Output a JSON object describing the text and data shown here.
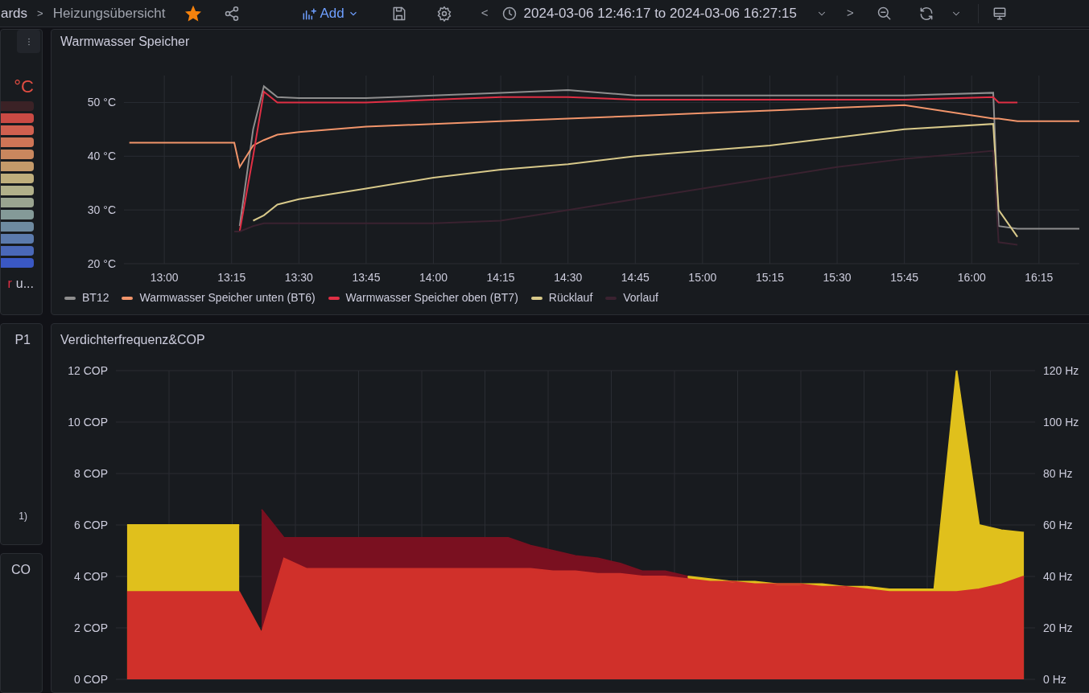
{
  "toolbar": {
    "breadcrumb_parent": "ards",
    "breadcrumb_separator": ">",
    "dashboard_title": "Heizungsübersicht",
    "starred": true,
    "add_label": "Add",
    "prev_label": "<",
    "time_range": "2024-03-06 12:46:17 to 2024-03-06 16:27:15",
    "next_label": ">"
  },
  "left_panels": [
    {
      "kind": "scale",
      "unit": "°C",
      "footer_lead": "r",
      "footer": "u..."
    },
    {
      "kind": "text",
      "title": "P1",
      "footer": "1)"
    },
    {
      "kind": "text",
      "title": "CO"
    }
  ],
  "panels": [
    {
      "title": "Warmwasser Speicher",
      "chart_data": {
        "type": "line",
        "grid": true,
        "xlim": [
          12.85,
          16.4
        ],
        "ylim": [
          20,
          55
        ],
        "yticks": [
          {
            "value": 20,
            "label": "20 °C"
          },
          {
            "value": 30,
            "label": "30 °C"
          },
          {
            "value": 40,
            "label": "40 °C"
          },
          {
            "value": 50,
            "label": "50 °C"
          }
        ],
        "xticks": [
          {
            "value": 13,
            "label": "13:00"
          },
          {
            "value": 13.25,
            "label": "13:15"
          },
          {
            "value": 13.5,
            "label": "13:30"
          },
          {
            "value": 13.75,
            "label": "13:45"
          },
          {
            "value": 14,
            "label": "14:00"
          },
          {
            "value": 14.25,
            "label": "14:15"
          },
          {
            "value": 14.5,
            "label": "14:30"
          },
          {
            "value": 14.75,
            "label": "14:45"
          },
          {
            "value": 15,
            "label": "15:00"
          },
          {
            "value": 15.25,
            "label": "15:15"
          },
          {
            "value": 15.5,
            "label": "15:30"
          },
          {
            "value": 15.75,
            "label": "15:45"
          },
          {
            "value": 16,
            "label": "16:00"
          },
          {
            "value": 16.25,
            "label": "16:15"
          }
        ],
        "x": [
          12.87,
          13.26,
          13.28,
          13.33,
          13.37,
          13.42,
          13.5,
          13.75,
          14,
          14.25,
          14.5,
          14.75,
          15,
          15.25,
          15.5,
          15.75,
          16.08,
          16.1,
          16.17,
          16.4
        ],
        "series": [
          {
            "name": "BT12",
            "color": "#8e8e8e",
            "values": [
              null,
              null,
              27,
              45,
              53,
              51,
              50.8,
              50.8,
              51.3,
              51.8,
              52.3,
              51.3,
              51.3,
              51.3,
              51.3,
              51.3,
              51.8,
              27,
              26.5,
              26.5
            ]
          },
          {
            "name": "Warmwasser Speicher unten (BT6)",
            "color": "#f2956b",
            "values": [
              42.5,
              42.5,
              38,
              42,
              43,
              44,
              44.5,
              45.5,
              46,
              46.5,
              47,
              47.5,
              48,
              48.5,
              49,
              49.5,
              47,
              47,
              46.5,
              46.5
            ]
          },
          {
            "name": "Warmwasser Speicher oben (BT7)",
            "color": "#e02f44",
            "values": [
              null,
              null,
              26,
              40,
              52,
              50,
              50,
              50,
              50.5,
              51,
              51,
              50.5,
              50.5,
              50.5,
              50.5,
              50.5,
              51,
              50,
              50,
              null
            ]
          },
          {
            "name": "Rücklauf",
            "color": "#d8c98a",
            "values": [
              null,
              null,
              null,
              28,
              29,
              31,
              32,
              34,
              36,
              37.5,
              38.5,
              40,
              41,
              42,
              43.5,
              45,
              46,
              30,
              25,
              null
            ]
          },
          {
            "name": "Vorlauf",
            "color": "#3a2230",
            "values": [
              null,
              26,
              26,
              27,
              27.5,
              27.5,
              27.5,
              27.5,
              27.5,
              28,
              30,
              32,
              34,
              36,
              38,
              39.5,
              41,
              24,
              23.5,
              null
            ]
          }
        ]
      }
    },
    {
      "title": "Verdichterfrequenz&COP",
      "chart_data": {
        "type": "area",
        "grid": true,
        "ylim": [
          0,
          12
        ],
        "y2lim": [
          0,
          120
        ],
        "yticks": [
          {
            "value": 0,
            "label": "0 COP"
          },
          {
            "value": 2,
            "label": "2 COP"
          },
          {
            "value": 4,
            "label": "4 COP"
          },
          {
            "value": 6,
            "label": "6 COP"
          },
          {
            "value": 8,
            "label": "8 COP"
          },
          {
            "value": 10,
            "label": "10 COP"
          },
          {
            "value": 12,
            "label": "12 COP"
          }
        ],
        "y2ticks": [
          {
            "value": 0,
            "label": "0 Hz"
          },
          {
            "value": 20,
            "label": "20 Hz"
          },
          {
            "value": 40,
            "label": "40 Hz"
          },
          {
            "value": 60,
            "label": "60 Hz"
          },
          {
            "value": 80,
            "label": "80 Hz"
          },
          {
            "value": 100,
            "label": "100 Hz"
          },
          {
            "value": 120,
            "label": "120 Hz"
          }
        ],
        "categories": [
          null,
          null,
          null,
          null,
          null,
          null,
          null,
          null,
          null,
          null,
          null,
          null,
          null,
          null,
          null,
          null,
          null,
          null,
          null,
          null,
          null,
          null,
          null,
          null,
          null,
          null,
          null,
          null,
          null,
          null,
          null,
          null,
          null,
          null,
          null,
          null,
          null,
          null,
          null,
          null,
          null
        ],
        "series": [
          {
            "color": "#e0c01c",
            "values": [
              6,
              6,
              6,
              6,
              6,
              6,
              null,
              null,
              null,
              null,
              null,
              null,
              null,
              null,
              null,
              null,
              null,
              null,
              null,
              null,
              null,
              null,
              null,
              null,
              null,
              4.0,
              3.9,
              3.8,
              3.8,
              3.7,
              3.7,
              3.7,
              3.6,
              3.6,
              3.5,
              3.5,
              3.5,
              12,
              6.0,
              5.8,
              5.7
            ]
          },
          {
            "color": "#7a1020",
            "axis": "y2",
            "values": [
              null,
              null,
              null,
              null,
              null,
              null,
              66,
              55,
              55,
              55,
              55,
              55,
              55,
              55,
              55,
              55,
              55,
              55,
              52,
              50,
              48,
              47,
              45,
              42,
              42,
              40,
              null,
              null,
              null,
              null,
              null,
              null,
              null,
              null,
              null,
              null,
              null,
              null,
              null,
              null,
              null
            ]
          },
          {
            "color": "#d0302a",
            "axis": "y2",
            "values": [
              34,
              34,
              34,
              34,
              34,
              34,
              18,
              47,
              43,
              43,
              43,
              43,
              43,
              43,
              43,
              43,
              43,
              43,
              43,
              42,
              42,
              41,
              41,
              40,
              40,
              39,
              38,
              38,
              37,
              37,
              37,
              36,
              36,
              35,
              34,
              34,
              34,
              34,
              35,
              37,
              40
            ]
          }
        ]
      }
    }
  ]
}
